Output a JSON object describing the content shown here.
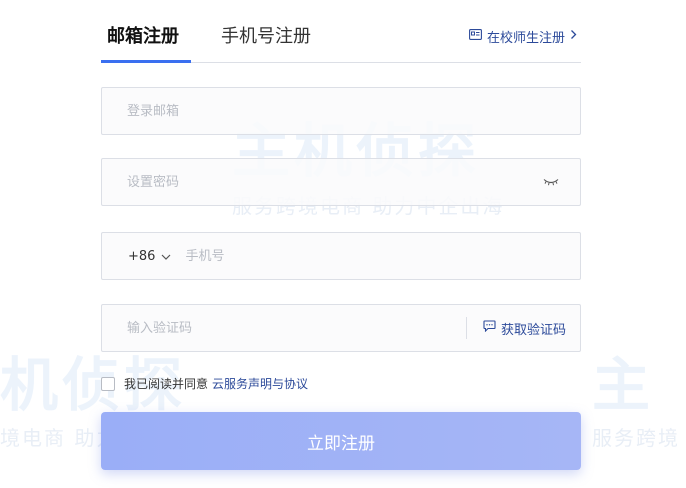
{
  "tabs": {
    "email": "邮箱注册",
    "phone": "手机号注册"
  },
  "student_link": "在校师生注册",
  "fields": {
    "email_placeholder": "登录邮箱",
    "password_placeholder": "设置密码",
    "country_code": "+86",
    "phone_placeholder": "手机号",
    "code_placeholder": "输入验证码",
    "get_code": "获取验证码"
  },
  "agreement": {
    "text": "我已阅读并同意",
    "link": "云服务声明与协议"
  },
  "submit_label": "立即注册",
  "watermark": {
    "logo": "主机侦探",
    "slogan": "服务跨境电商 助力中企出海",
    "slogan_left": "境电商 助力中企出海",
    "slogan_right": "服务跨境",
    "logo_left": "机侦探",
    "logo_right": "主"
  },
  "colors": {
    "accent": "#3a6ff0",
    "link": "#2c4a9a",
    "button": "#9aaef7"
  }
}
